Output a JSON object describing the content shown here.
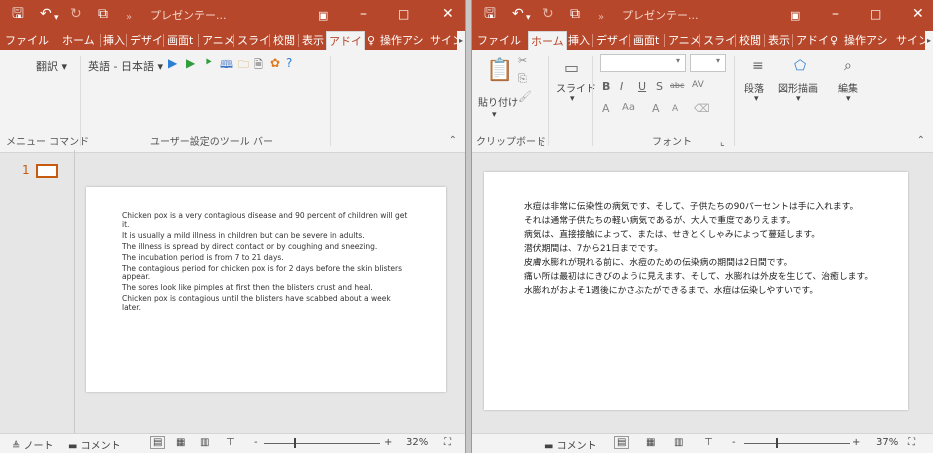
{
  "left": {
    "titlebar": {
      "title": "プレゼンテー..."
    },
    "tabs": [
      "ファイル",
      "ホーム",
      "挿入",
      "デザイ",
      "画面t",
      "アニメ",
      "スライ",
      "校閲",
      "表示",
      "アドイ",
      "操作アシ",
      "サイン"
    ],
    "ribbon": {
      "translate_label": "翻訳",
      "lang_select": "英語 - 日本語",
      "group_menu": "メニュー コマンド",
      "group_toolbar": "ユーザー設定のツール バー"
    },
    "thumbnail_number": "1",
    "slide_lines": [
      "Chicken pox is a very contagious disease and 90 percent of children will get it.",
      "It is usually a mild illness in children but can be severe in adults.",
      "The illness is spread by direct contact or by coughing and sneezing.",
      "The incubation period is from 7 to 21 days.",
      "The contagious period for chicken pox is for 2 days before the skin blisters appear.",
      "The sores look like pimples at first then the blisters crust and heal.",
      "Chicken pox is contagious until the blisters have scabbed about a week later."
    ],
    "statusbar": {
      "notes": "ノート",
      "comments": "コメント",
      "zoom_minus": "-",
      "zoom_plus": "+",
      "zoom": "32%"
    }
  },
  "right": {
    "titlebar": {
      "title": "プレゼンテー..."
    },
    "tabs": [
      "ファイル",
      "ホーム",
      "挿入",
      "デザイ",
      "画面t",
      "アニメ",
      "スライ",
      "校閲",
      "表示",
      "アドイ",
      "操作アシ",
      "サイン"
    ],
    "ribbon": {
      "paste": "貼り付け",
      "slide": "スライド",
      "paragraph": "段落",
      "drawing": "図形描画",
      "editing": "編集",
      "group_clipboard": "クリップボード",
      "group_font": "フォント",
      "font_bold": "B",
      "font_italic": "I",
      "font_underline": "U",
      "font_strike": "S",
      "font_abc": "abc",
      "font_spacing": "AV",
      "font_a": "A",
      "font_aa": "Aa"
    },
    "slide_lines": [
      "水痘は非常に伝染性の病気です、そして、子供たちの90パーセントは手に入れます。",
      "それは通常子供たちの軽い病気であるが、大人で重度でありえます。",
      "病気は、直接接触によって、または、せきとくしゃみによって蔓延します。",
      "潜伏期間は、7から21日までです。",
      "皮膚水膨れが現れる前に、水痘のための伝染病の期間は2日間です。",
      "痛い所は最初はにきびのように見えます、そして、水膨れは外皮を生じて、治癒します。",
      "水膨れがおよそ1週後にかさぶたができるまで、水痘は伝染しやすいです。"
    ],
    "statusbar": {
      "comments": "コメント",
      "zoom_minus": "-",
      "zoom_plus": "+",
      "zoom": "37%"
    }
  },
  "colors": {
    "accent": "#b7472a",
    "ribbon_bg": "#f3f3f3",
    "canvas_bg": "#e6e6e6"
  }
}
